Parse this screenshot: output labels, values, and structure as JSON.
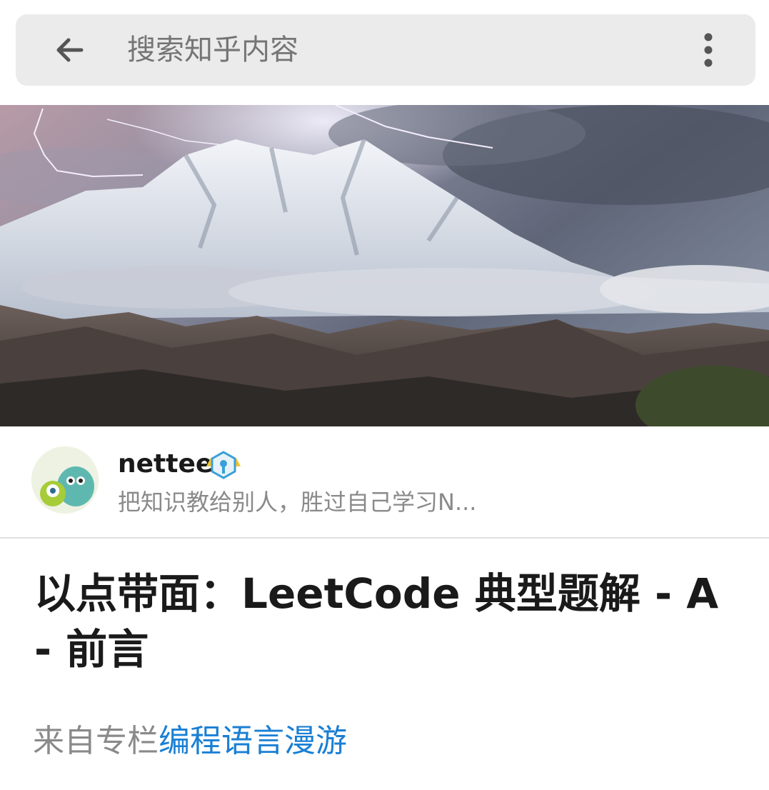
{
  "search": {
    "placeholder": "搜索知乎内容",
    "back_icon": "arrow-left-icon",
    "more_icon": "more-vertical-icon"
  },
  "hero": {
    "image_description_icon": "mountain-landscape-image"
  },
  "author": {
    "name": "nettee",
    "bio": "把知识教给别人，胜过自己学习N...",
    "badge_icon": "verified-badge-icon"
  },
  "article": {
    "title": "以点带面：LeetCode 典型题解 - A - 前言"
  },
  "column": {
    "prefix": "来自专栏",
    "name": "编程语言漫游"
  },
  "colors": {
    "link": "#1a7fd4",
    "searchbar_bg": "#ebebeb",
    "secondary_text": "#8a8a8a"
  }
}
